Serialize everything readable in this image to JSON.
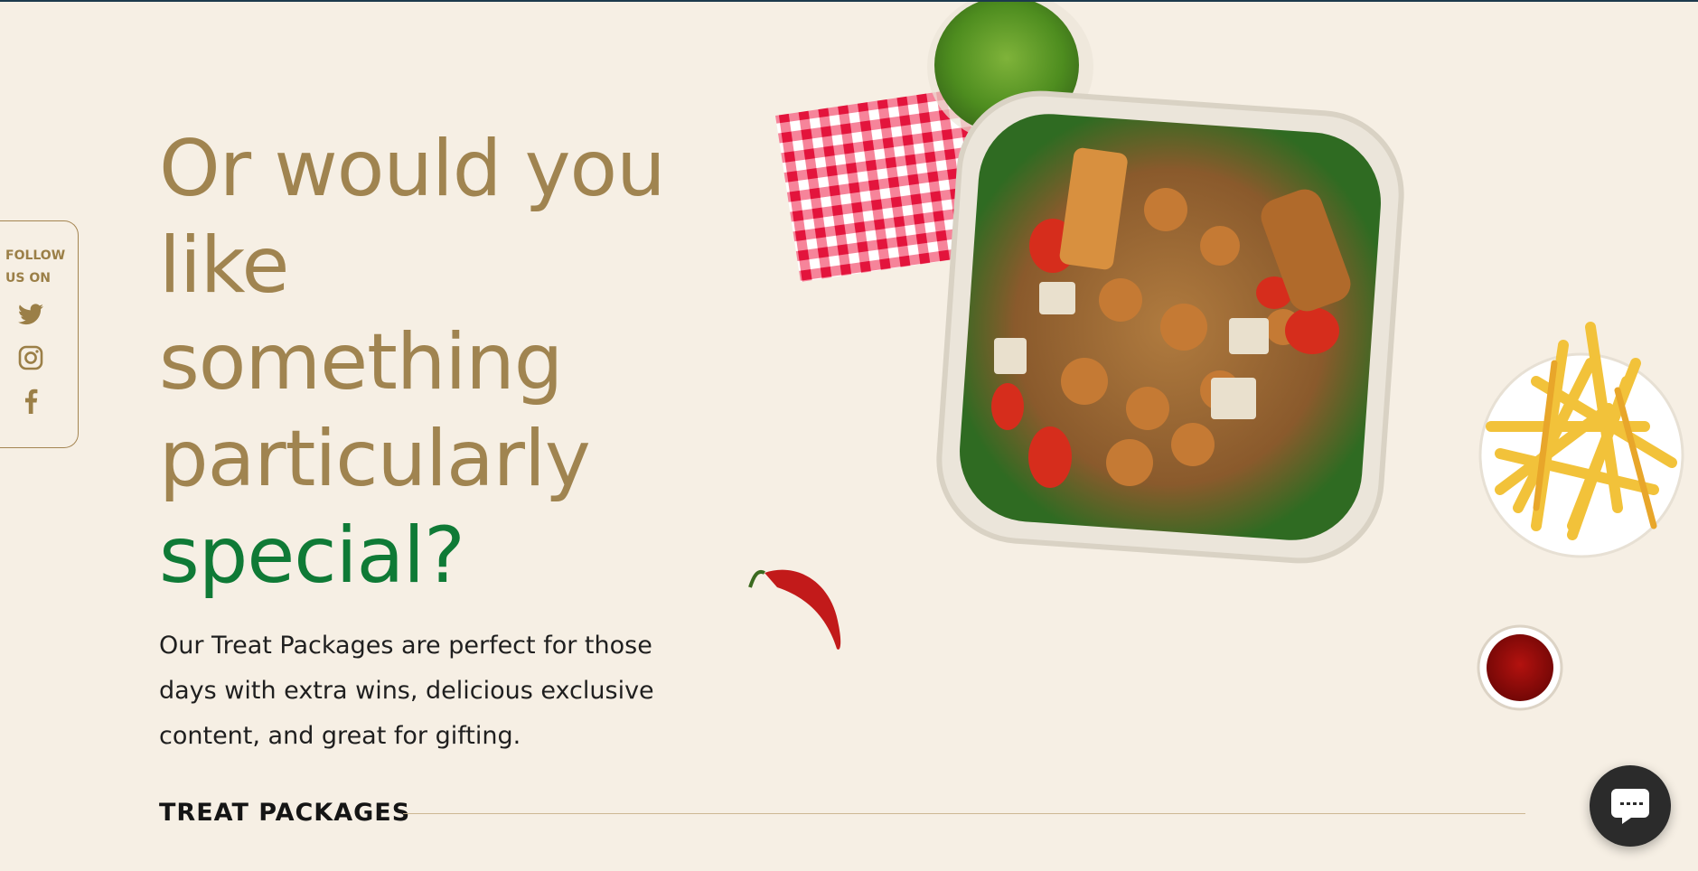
{
  "follow": {
    "label": "FOLLOW\nUS ON",
    "icons": [
      "twitter-icon",
      "instagram-icon",
      "facebook-icon"
    ]
  },
  "hero": {
    "headline_lines": [
      "Or would you",
      "like",
      "something",
      "particularly"
    ],
    "headline_accent": "special?",
    "description": "Our Treat Packages are perfect for those days with extra wins, delicious exclusive content, and great for gifting."
  },
  "section": {
    "title": "TREAT PACKAGES"
  },
  "chat": {
    "icon": "chat-bubble-icon"
  },
  "colors": {
    "background": "#f6efe4",
    "headline": "#a08450",
    "accent": "#0f7a36",
    "text": "#1f1f1f",
    "border": "#a48552"
  }
}
